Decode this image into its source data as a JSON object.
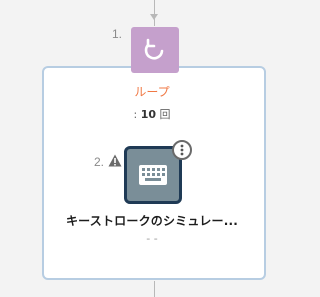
{
  "flow": {
    "loop_step": {
      "number": "1.",
      "title": "ループ",
      "count_prefix": ": ",
      "count_value": "10",
      "count_unit": "回",
      "icon": "loop-icon",
      "color": "#c5a0cc",
      "title_color": "#f07844"
    },
    "action_step": {
      "number": "2.",
      "label": "キーストロークのシミュレー...",
      "sub": "- -",
      "icon": "keyboard-icon",
      "warning_icon": "warning-icon",
      "more_icon": "more-vertical-icon",
      "color": "#7a8e98",
      "border_color": "#1f3a55"
    },
    "container_border_color": "#b7cde2",
    "connector_color": "#b8b8b8"
  }
}
